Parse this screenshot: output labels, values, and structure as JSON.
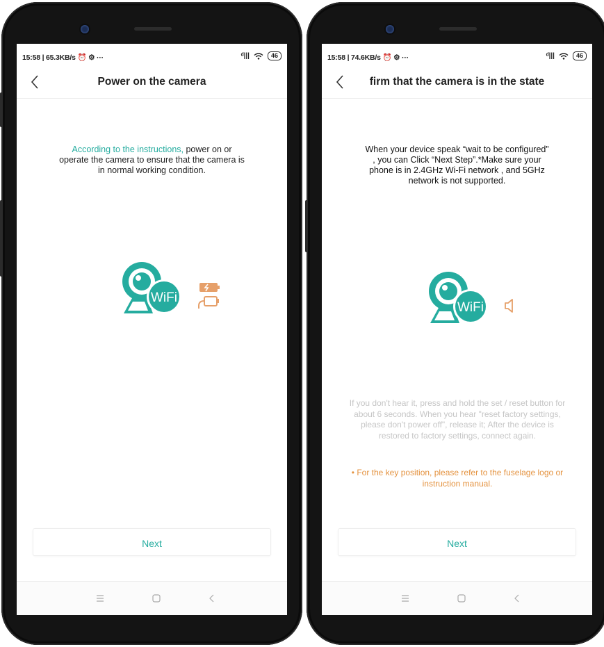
{
  "phones": [
    {
      "status": {
        "left": "15:58 | 65.3KB/s ⏰ ⚙ ···",
        "signal": "ᵈ|||",
        "battery": "46"
      },
      "title": "Power on the camera",
      "instructions": {
        "highlight": "According to the instructions,",
        "body": " power on or operate the camera to ensure that the camera is in normal working condition."
      },
      "illustration": {
        "badge": "WiFi"
      },
      "next_label": "Next"
    },
    {
      "status": {
        "left": "15:58 | 74.6KB/s ⏰ ⚙ ···",
        "signal": "ᵈ|||",
        "battery": "46"
      },
      "title": "firm that the camera is in the state",
      "instructions": {
        "body": "When your device speak “wait to be configured” , you can Click “Next Step”.*Make sure your phone is in 2.4GHz Wi-Fi network , and 5GHz network is not supported."
      },
      "illustration": {
        "badge": "WiFi"
      },
      "hint": "If you don't hear it, press and hold the set / reset button for about 6 seconds. When you hear \"reset factory settings, please don't power off\", release it; After the device is restored to factory settings, connect again.",
      "note": "• For the key position, please refer to the fuselage logo or instruction manual.",
      "next_label": "Next"
    }
  ],
  "colors": {
    "accent": "#25ac9f",
    "warning": "#e4923f",
    "icon_peach": "#e6a06a",
    "hint": "#c6c6c6"
  },
  "icons": {
    "back": "chevron-left-icon",
    "menu": "menu-icon",
    "home": "home-icon",
    "back_nav": "triangle-back-icon",
    "speaker": "speaker-icon"
  }
}
